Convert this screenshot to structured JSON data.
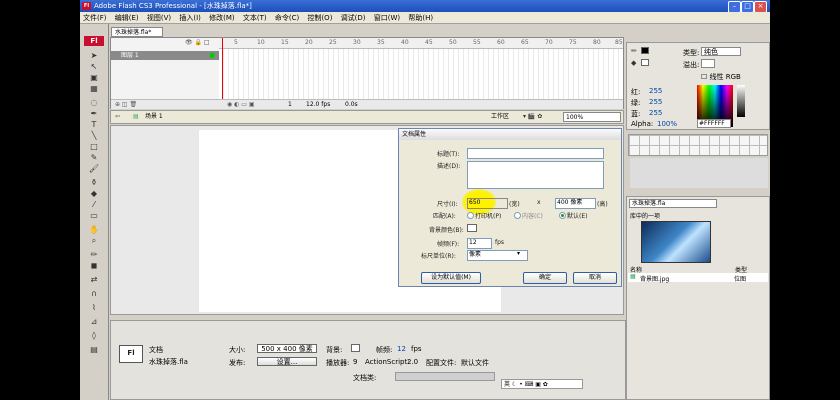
{
  "app": {
    "title": "Adobe Flash CS3 Professional - [水珠掉落.fla*]",
    "logo": "Fl"
  },
  "menu": [
    "文件(F)",
    "编辑(E)",
    "视图(V)",
    "插入(I)",
    "修改(M)",
    "文本(T)",
    "命令(C)",
    "控制(O)",
    "调试(D)",
    "窗口(W)",
    "帮助(H)"
  ],
  "document": {
    "tab": "水珠掉落.fla*"
  },
  "timeline": {
    "layer": "图层 1",
    "ticks": [
      "5",
      "10",
      "15",
      "20",
      "25",
      "30",
      "35",
      "40",
      "45",
      "50",
      "55",
      "60",
      "65",
      "70",
      "75",
      "80",
      "85"
    ],
    "frame": "1",
    "fps": "12.0 fps",
    "time": "0.0s"
  },
  "scene": {
    "name": "场景 1",
    "workspace": "工作区",
    "zoom": "100%"
  },
  "dialog": {
    "title": "文档属性",
    "title_label": "标题(T):",
    "desc_label": "描述(D):",
    "size_label": "尺寸(I):",
    "width": "650",
    "width_unit": "(宽)",
    "x": "x",
    "height": "400 像素",
    "height_unit": "(高)",
    "match_label": "匹配(A):",
    "match_printer": "打印机(P)",
    "match_contents": "内容(C)",
    "match_default": "默认(E)",
    "bg_label": "背景颜色(B):",
    "fps_label": "帧频(F):",
    "fps_value": "12",
    "fps_unit": "fps",
    "ruler_label": "标尺单位(R):",
    "ruler_value": "像素",
    "default_btn": "设为默认值(M)",
    "ok_btn": "确定",
    "cancel_btn": "取消"
  },
  "props": {
    "type": "文档",
    "file": "水珠掉落.fla",
    "size_label": "大小:",
    "size_value": "500 x 400 像素",
    "bg_label": "背景:",
    "fps_label": "帧频:",
    "fps_value": "12",
    "fps_unit": "fps",
    "publish_label": "发布:",
    "settings_btn": "设置...",
    "player_label": "播放器:",
    "player_value": "9",
    "as_label": "ActionScript:",
    "as_value": "2.0",
    "profile_label": "配置文件:",
    "profile_value": "默认文件",
    "docclass_label": "文档类:"
  },
  "color": {
    "type_label": "类型:",
    "type_value": "纯色",
    "overflow_label": "溢出:",
    "linear_rgb": "线性 RGB",
    "r_label": "红:",
    "r": "255",
    "g_label": "绿:",
    "g": "255",
    "b_label": "蓝:",
    "b": "255",
    "alpha_label": "Alpha:",
    "alpha": "100%",
    "hex": "#FFFFFF"
  },
  "library": {
    "doc": "水珠掉落.fla",
    "count": "库中的一项",
    "col_name": "名称",
    "col_type": "类型",
    "item_name": "背景图.jpg",
    "item_type": "位图"
  },
  "ime": "英"
}
